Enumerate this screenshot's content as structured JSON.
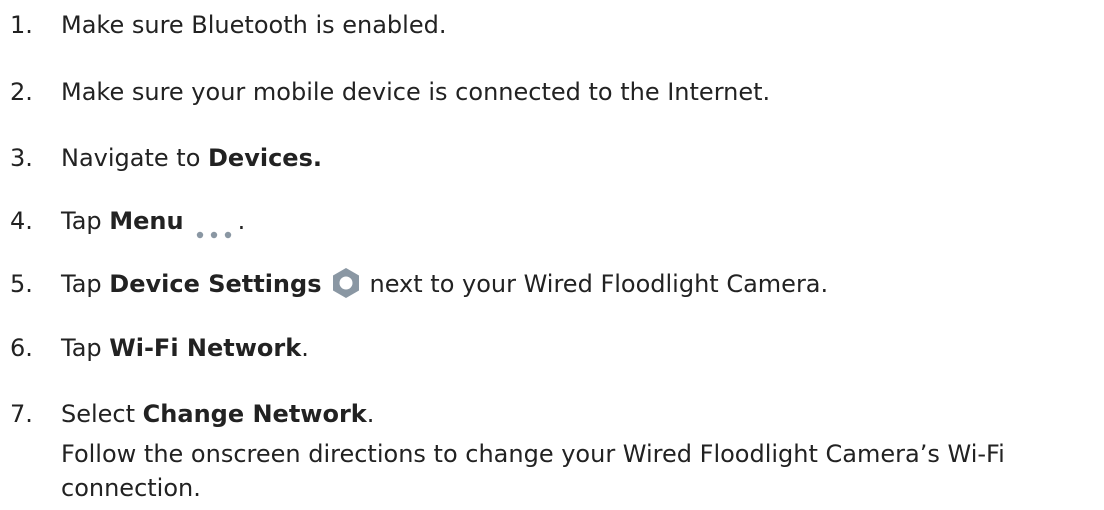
{
  "steps": [
    {
      "number": "1.",
      "text": "Make sure Bluetooth is enabled."
    },
    {
      "number": "2.",
      "text": "Make sure your mobile device is connected to the Internet."
    },
    {
      "number": "3.",
      "prefix": "Navigate to ",
      "bold": "Devices."
    },
    {
      "number": "4.",
      "prefix": "Tap ",
      "bold": "Menu",
      "icon": "more-horizontal-icon",
      "suffix": "."
    },
    {
      "number": "5.",
      "prefix": "Tap ",
      "bold": "Device Settings",
      "icon": "gear-icon",
      "suffix": "next to your Wired Floodlight Camera."
    },
    {
      "number": "6.",
      "prefix": "Tap ",
      "bold": "Wi-Fi Network",
      "suffix": "."
    },
    {
      "number": "7.",
      "prefix": "Select ",
      "bold": "Change Network",
      "suffix": ".",
      "subtext": "Follow the onscreen directions to change your Wired Floodlight Camera’s Wi-Fi connection."
    }
  ],
  "colors": {
    "text": "#222222",
    "icon_gray": "#8a97a3"
  }
}
